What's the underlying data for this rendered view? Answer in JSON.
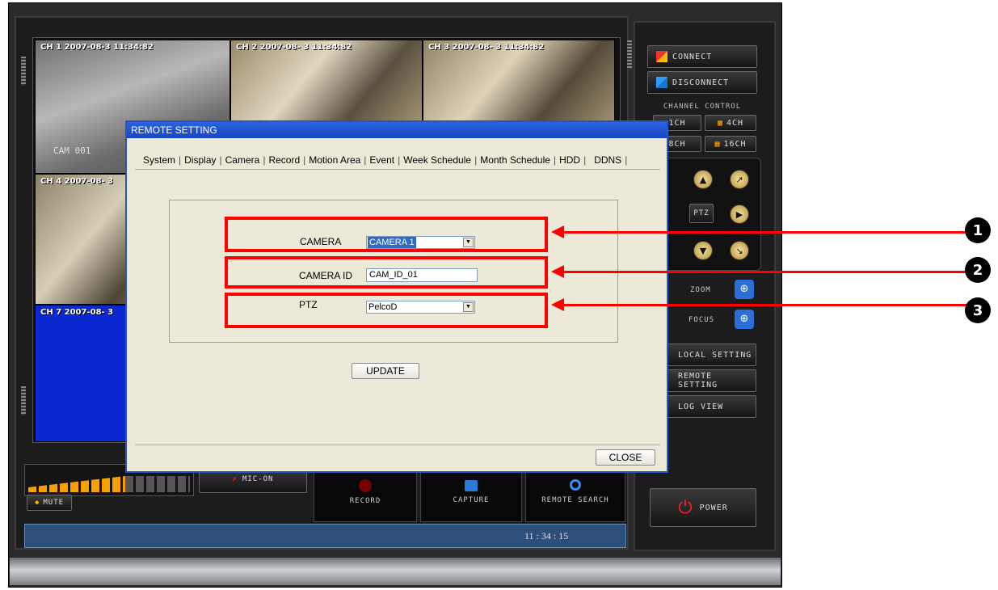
{
  "cameras": [
    {
      "label": "CH 1 2007-08-3 11:34:82",
      "name": "CAM 001"
    },
    {
      "label": "CH 2 2007-08- 3 11:34:82"
    },
    {
      "label": "CH 3 2007-08- 3 11:34:82"
    },
    {
      "label": "CH 4 2007-08- 3"
    },
    {
      "label": "CH 7 2007-08- 3"
    }
  ],
  "right_panel": {
    "connect": "CONNECT",
    "disconnect": "DISCONNECT",
    "channel_control": "CHANNEL CONTROL",
    "ch1": "1CH",
    "ch4": "4CH",
    "ch8": "8CH",
    "ch16": "16CH",
    "ptz": "PTZ",
    "zoom": "ZOOM",
    "focus": "FOCUS",
    "local_setting": "LOCAL SETTING",
    "remote_setting": "REMOTE SETTING",
    "log_view": "LOG VIEW",
    "power": "POWER"
  },
  "bottom": {
    "mute": "MUTE",
    "mic_on": "MIC-ON",
    "record": "RECORD",
    "capture": "CAPTURE",
    "remote_search": "REMOTE SEARCH",
    "time": "11 : 34 : 15"
  },
  "dialog": {
    "title": "REMOTE SETTING",
    "tabs": [
      "System",
      "Display",
      "Camera",
      "Record",
      "Motion Area",
      "Event",
      "Week Schedule",
      "Month Schedule",
      "HDD",
      "DDNS"
    ],
    "active_tab": "Camera",
    "camera_label": "CAMERA",
    "camera_value": "CAMERA 1",
    "camera_id_label": "CAMERA ID",
    "camera_id_value": "CAM_ID_01",
    "ptz_label": "PTZ",
    "ptz_value": "PelcoD",
    "update": "UPDATE",
    "close": "CLOSE"
  },
  "annotations": [
    "1",
    "2",
    "3"
  ],
  "colors": {
    "annotation": "#ff0000",
    "titlebar": "#2456c8",
    "dialog_bg": "#ece9d8"
  }
}
